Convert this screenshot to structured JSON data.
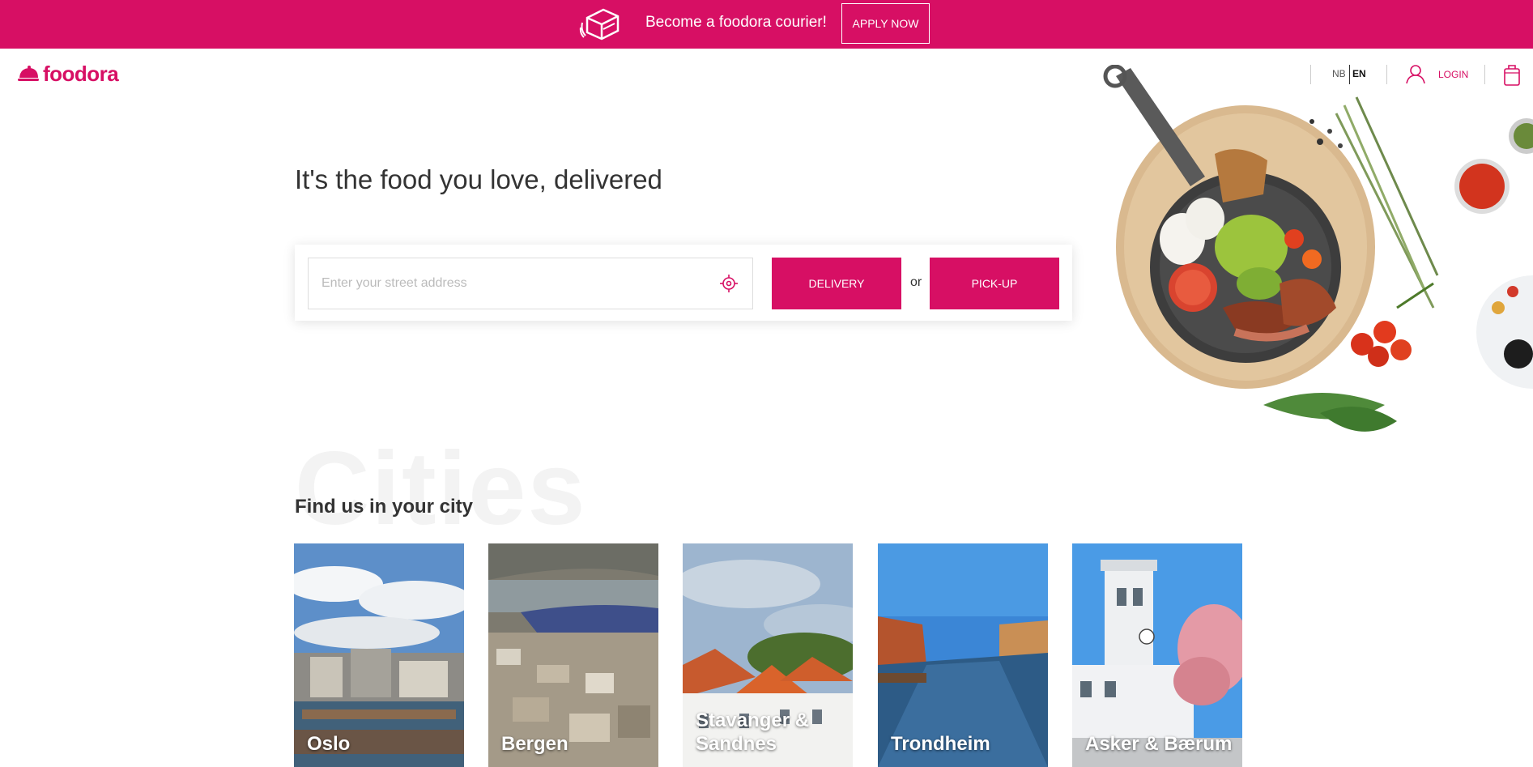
{
  "banner": {
    "text": "Become a foodora courier!",
    "apply_label": "APPLY NOW",
    "icon": "courier-bag-icon"
  },
  "header": {
    "logo_text": "foodora",
    "lang_nb": "NB",
    "lang_en": "EN",
    "login_label": "LOGIN",
    "icons": [
      "foodora-logo-icon",
      "user-icon",
      "cart-icon"
    ]
  },
  "hero": {
    "title": "It's the food you love, delivered",
    "search": {
      "placeholder": "Enter your street address",
      "value": ""
    },
    "delivery_label": "DELIVERY",
    "or_label": "or",
    "pickup_label": "PICK-UP"
  },
  "cities": {
    "watermark": "Cities",
    "title": "Find us in your city",
    "items": [
      {
        "name": "Oslo"
      },
      {
        "name": "Bergen"
      },
      {
        "name": "Stavanger & Sandnes"
      },
      {
        "name": "Trondheim"
      },
      {
        "name": "Asker & Bærum"
      }
    ]
  },
  "colors": {
    "brand": "#d70f64",
    "text": "#333333"
  }
}
